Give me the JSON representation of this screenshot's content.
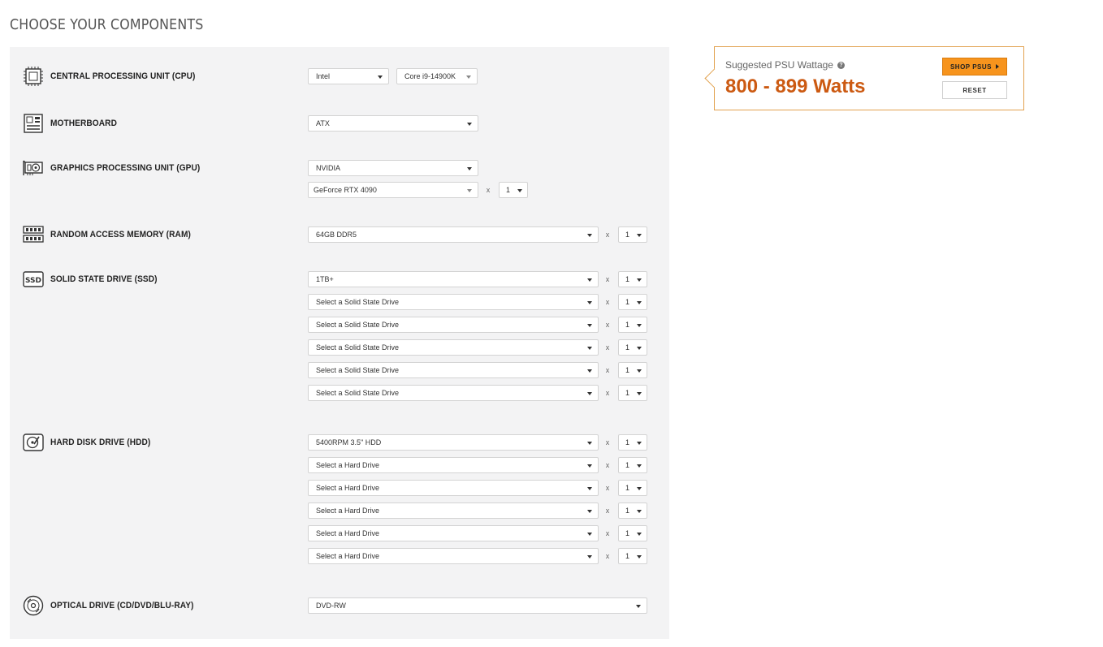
{
  "page": {
    "heading": "CHOOSE YOUR COMPONENTS"
  },
  "components": {
    "cpu": {
      "title": "CENTRAL PROCESSING UNIT (CPU)",
      "icon": "cpu-icon",
      "brand": "Intel",
      "model": "Core i9-14900K"
    },
    "motherboard": {
      "title": "MOTHERBOARD",
      "icon": "motherboard-icon",
      "form_factor": "ATX"
    },
    "gpu": {
      "title": "GRAPHICS PROCESSING UNIT (GPU)",
      "icon": "gpu-icon",
      "brand": "NVIDIA",
      "model": "GeForce RTX 4090",
      "qty": "1"
    },
    "ram": {
      "title": "RANDOM ACCESS MEMORY (RAM)",
      "icon": "ram-icon",
      "value": "64GB DDR5",
      "qty": "1"
    },
    "ssd": {
      "title": "SOLID STATE DRIVE (SSD)",
      "icon": "ssd-icon",
      "rows": [
        {
          "value": "1TB+",
          "qty": "1"
        },
        {
          "value": "Select a Solid State Drive",
          "qty": "1"
        },
        {
          "value": "Select a Solid State Drive",
          "qty": "1"
        },
        {
          "value": "Select a Solid State Drive",
          "qty": "1"
        },
        {
          "value": "Select a Solid State Drive",
          "qty": "1"
        },
        {
          "value": "Select a Solid State Drive",
          "qty": "1"
        }
      ]
    },
    "hdd": {
      "title": "HARD DISK DRIVE (HDD)",
      "icon": "hdd-icon",
      "rows": [
        {
          "value": "5400RPM 3.5\" HDD",
          "qty": "1"
        },
        {
          "value": "Select a Hard Drive",
          "qty": "1"
        },
        {
          "value": "Select a Hard Drive",
          "qty": "1"
        },
        {
          "value": "Select a Hard Drive",
          "qty": "1"
        },
        {
          "value": "Select a Hard Drive",
          "qty": "1"
        },
        {
          "value": "Select a Hard Drive",
          "qty": "1"
        }
      ]
    },
    "optical": {
      "title": "OPTICAL DRIVE (CD/DVD/BLU-RAY)",
      "icon": "optical-drive-icon",
      "value": "DVD-RW"
    }
  },
  "multiply_symbol": "x",
  "psu": {
    "label": "Suggested PSU Wattage",
    "help_icon": "question-circle-icon",
    "help_glyph": "?",
    "value": "800 - 899 Watts",
    "shop_label": "SHOP PSUS",
    "reset_label": "RESET",
    "accent_color": "#cc5a12",
    "button_color": "#f7941d",
    "border_color": "#e2a24f"
  }
}
